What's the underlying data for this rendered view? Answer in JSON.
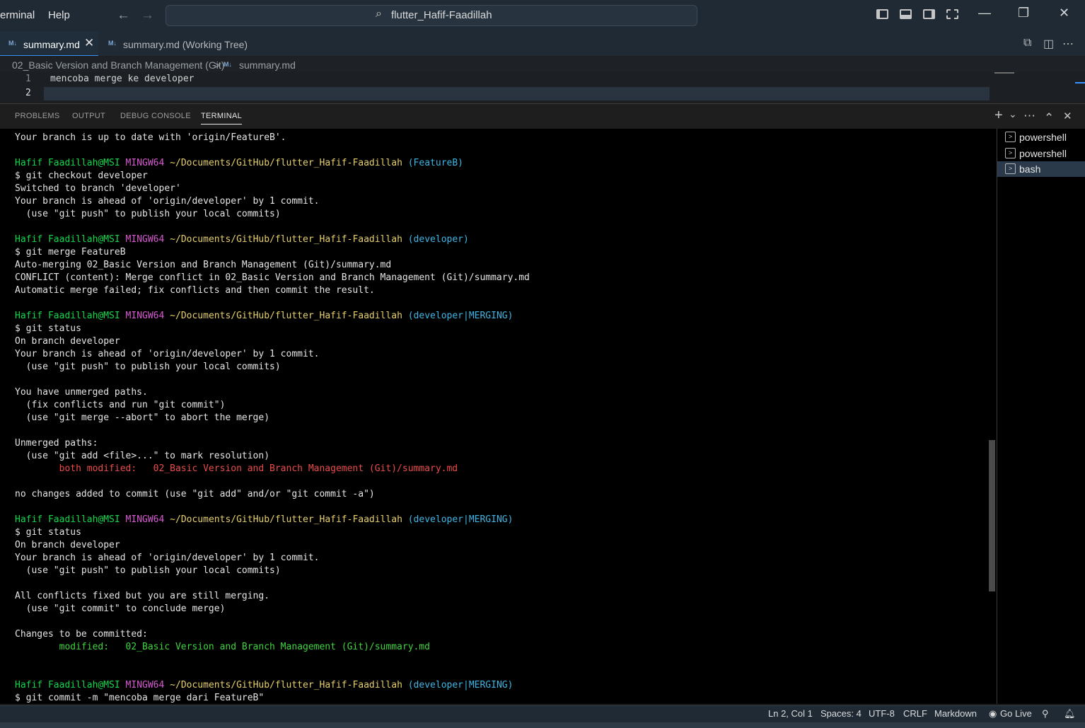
{
  "menu": {
    "terminal": "erminal",
    "help": "Help"
  },
  "nav": {
    "back": "←",
    "forward": "→"
  },
  "search": {
    "text": "flutter_Hafif-Faadillah"
  },
  "window": {
    "minimize": "—",
    "restore": "❐",
    "close": "✕"
  },
  "tabs": [
    {
      "icon": "M↓",
      "label": "summary.md",
      "close": "✕"
    },
    {
      "icon": "M↓",
      "label": "summary.md (Working Tree)"
    }
  ],
  "tab_actions": {
    "compare": "⧉",
    "split": "◫",
    "more": "⋯"
  },
  "breadcrumb": {
    "folder": "02_Basic Version and Branch Management (Git)",
    "sep": ">",
    "icon": "M↓",
    "file": "summary.md"
  },
  "editor": {
    "lines": [
      {
        "num": "1",
        "text": "mencoba merge ke developer"
      },
      {
        "num": "2",
        "text": ""
      }
    ]
  },
  "panel": {
    "tabs": [
      "PROBLEMS",
      "OUTPUT",
      "DEBUG CONSOLE",
      "TERMINAL"
    ],
    "actions": {
      "add": "+",
      "dropdown": "⌄",
      "more": "⋯",
      "maximize": "⌃",
      "close": "✕"
    }
  },
  "terminal_lines": [
    [
      [
        "Your branch is up to date with 'origin/FeatureB'.",
        ""
      ]
    ],
    [],
    [
      [
        "Hafif Faadillah@MSI",
        "g"
      ],
      [
        " ",
        ""
      ],
      [
        "MINGW64",
        "m"
      ],
      [
        " ",
        ""
      ],
      [
        "~/Documents/GitHub/flutter_Hafif-Faadillah",
        "y"
      ],
      [
        " ",
        ""
      ],
      [
        "(FeatureB)",
        "c"
      ]
    ],
    [
      [
        "$ git checkout developer",
        ""
      ]
    ],
    [
      [
        "Switched to branch 'developer'",
        ""
      ]
    ],
    [
      [
        "Your branch is ahead of 'origin/developer' by 1 commit.",
        ""
      ]
    ],
    [
      [
        "  (use \"git push\" to publish your local commits)",
        ""
      ]
    ],
    [],
    [
      [
        "Hafif Faadillah@MSI",
        "g"
      ],
      [
        " ",
        ""
      ],
      [
        "MINGW64",
        "m"
      ],
      [
        " ",
        ""
      ],
      [
        "~/Documents/GitHub/flutter_Hafif-Faadillah",
        "y"
      ],
      [
        " ",
        ""
      ],
      [
        "(developer)",
        "c"
      ]
    ],
    [
      [
        "$ git merge FeatureB",
        ""
      ]
    ],
    [
      [
        "Auto-merging 02_Basic Version and Branch Management (Git)/summary.md",
        ""
      ]
    ],
    [
      [
        "CONFLICT (content): Merge conflict in 02_Basic Version and Branch Management (Git)/summary.md",
        ""
      ]
    ],
    [
      [
        "Automatic merge failed; fix conflicts and then commit the result.",
        ""
      ]
    ],
    [],
    [
      [
        "Hafif Faadillah@MSI",
        "g"
      ],
      [
        " ",
        ""
      ],
      [
        "MINGW64",
        "m"
      ],
      [
        " ",
        ""
      ],
      [
        "~/Documents/GitHub/flutter_Hafif-Faadillah",
        "y"
      ],
      [
        " ",
        ""
      ],
      [
        "(developer|MERGING)",
        "c"
      ]
    ],
    [
      [
        "$ git status",
        ""
      ]
    ],
    [
      [
        "On branch developer",
        ""
      ]
    ],
    [
      [
        "Your branch is ahead of 'origin/developer' by 1 commit.",
        ""
      ]
    ],
    [
      [
        "  (use \"git push\" to publish your local commits)",
        ""
      ]
    ],
    [],
    [
      [
        "You have unmerged paths.",
        ""
      ]
    ],
    [
      [
        "  (fix conflicts and run \"git commit\")",
        ""
      ]
    ],
    [
      [
        "  (use \"git merge --abort\" to abort the merge)",
        ""
      ]
    ],
    [],
    [
      [
        "Unmerged paths:",
        ""
      ]
    ],
    [
      [
        "  (use \"git add <file>...\" to mark resolution)",
        ""
      ]
    ],
    [
      [
        "        both modified:   02_Basic Version and Branch Management (Git)/summary.md",
        "r"
      ]
    ],
    [],
    [
      [
        "no changes added to commit (use \"git add\" and/or \"git commit -a\")",
        ""
      ]
    ],
    [],
    [
      [
        "Hafif Faadillah@MSI",
        "g"
      ],
      [
        " ",
        ""
      ],
      [
        "MINGW64",
        "m"
      ],
      [
        " ",
        ""
      ],
      [
        "~/Documents/GitHub/flutter_Hafif-Faadillah",
        "y"
      ],
      [
        " ",
        ""
      ],
      [
        "(developer|MERGING)",
        "c"
      ]
    ],
    [
      [
        "$ git status",
        ""
      ]
    ],
    [
      [
        "On branch developer",
        ""
      ]
    ],
    [
      [
        "Your branch is ahead of 'origin/developer' by 1 commit.",
        ""
      ]
    ],
    [
      [
        "  (use \"git push\" to publish your local commits)",
        ""
      ]
    ],
    [],
    [
      [
        "All conflicts fixed but you are still merging.",
        ""
      ]
    ],
    [
      [
        "  (use \"git commit\" to conclude merge)",
        ""
      ]
    ],
    [],
    [
      [
        "Changes to be committed:",
        ""
      ]
    ],
    [
      [
        "        modified:   02_Basic Version and Branch Management (Git)/summary.md",
        "o"
      ]
    ],
    [],
    [],
    [
      [
        "Hafif Faadillah@MSI",
        "g"
      ],
      [
        " ",
        ""
      ],
      [
        "MINGW64",
        "m"
      ],
      [
        " ",
        ""
      ],
      [
        "~/Documents/GitHub/flutter_Hafif-Faadillah",
        "y"
      ],
      [
        " ",
        ""
      ],
      [
        "(developer|MERGING)",
        "c"
      ]
    ],
    [
      [
        "$ git commit -m \"mencoba merge dari FeatureB\"",
        ""
      ]
    ]
  ],
  "terminal_list": [
    "powershell",
    "powershell",
    "bash"
  ],
  "status": {
    "position": "Ln 2, Col 1",
    "spaces": "Spaces: 4",
    "encoding": "UTF-8",
    "eol": "CRLF",
    "language": "Markdown",
    "golive": "Go Live"
  },
  "colors": {
    "prompt_user": "#13d84b",
    "prompt_host": "#d65ad0",
    "prompt_path": "#e6d06b",
    "prompt_branch": "#3fb6e6",
    "conflict": "#ea4b4b",
    "staged": "#3fd43f"
  }
}
